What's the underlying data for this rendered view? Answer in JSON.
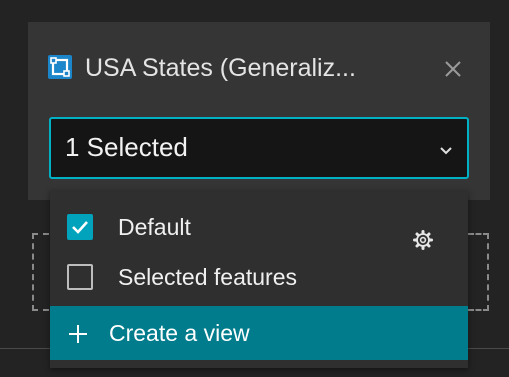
{
  "panel": {
    "title": "USA States (Generaliz...",
    "layer_icon": "layer-selection-icon",
    "close_icon": "close-icon"
  },
  "select": {
    "value": "1 Selected",
    "icon": "chevron-down-icon"
  },
  "dropdown": {
    "options": [
      {
        "label": "Default",
        "checked": true,
        "icon": "gear-icon"
      },
      {
        "label": "Selected features",
        "checked": false
      }
    ],
    "create_label": "Create a view",
    "create_icon": "plus-icon"
  },
  "colors": {
    "accent": "#00b0c4",
    "checkbox_fill": "#00a3bb",
    "highlight": "#007c8c",
    "layer_icon": "#1b86c9"
  }
}
